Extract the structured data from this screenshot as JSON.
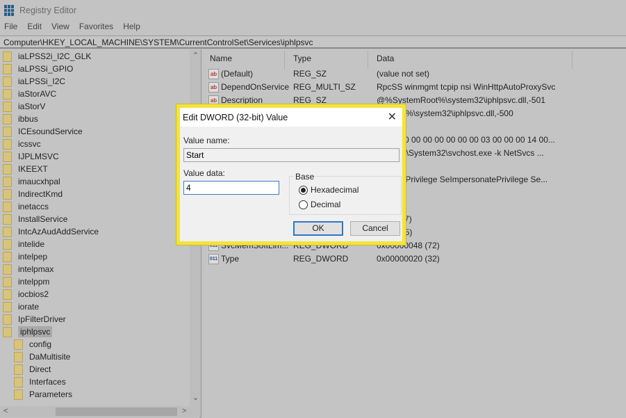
{
  "window": {
    "title": "Registry Editor",
    "app_icon": "registry-editor-icon"
  },
  "menu": [
    "File",
    "Edit",
    "View",
    "Favorites",
    "Help"
  ],
  "address": "Computer\\HKEY_LOCAL_MACHINE\\SYSTEM\\CurrentControlSet\\Services\\iphlpsvc",
  "tree": {
    "items": [
      "iaLPSS2i_I2C_GLK",
      "iaLPSSi_GPIO",
      "iaLPSSi_I2C",
      "iaStorAVC",
      "iaStorV",
      "ibbus",
      "ICEsoundService",
      "icssvc",
      "IJPLMSVC",
      "IKEEXT",
      "imaucxhpal",
      "IndirectKmd",
      "inetaccs",
      "InstallService",
      "IntcAzAudAddService",
      "intelide",
      "intelpep",
      "intelpmax",
      "intelppm",
      "iocbios2",
      "iorate",
      "IpFilterDriver",
      "iphlpsvc"
    ],
    "selected": "iphlpsvc",
    "children": [
      "config",
      "DaMultisite",
      "Direct",
      "Interfaces",
      "Parameters"
    ]
  },
  "list": {
    "headers": {
      "name": "Name",
      "type": "Type",
      "data": "Data"
    },
    "rows": [
      {
        "icon": "string-value-icon",
        "name": "(Default)",
        "type": "REG_SZ",
        "data": "(value not set)"
      },
      {
        "icon": "string-value-icon",
        "name": "DependOnService",
        "type": "REG_MULTI_SZ",
        "data": "RpcSS winmgmt tcpip nsi WinHttpAutoProxySvc"
      },
      {
        "icon": "string-value-icon",
        "name": "Description",
        "type": "REG_SZ",
        "data": "@%SystemRoot%\\system32\\iphlpsvc.dll,-501"
      },
      {
        "data": "emRoot%\\system32\\iphlpsvc.dll,-500"
      },
      {
        "data": "001 (1)"
      },
      {
        "data": "00 00 00 00 00 00 00 00 00 03 00 00 00 14 00..."
      },
      {
        "data": "nRoot%\\System32\\svchost.exe -k NetSvcs ..."
      },
      {
        "data": "stem"
      },
      {
        "data": "eGlobalPrivilege SeImpersonatePrivilege Se..."
      },
      {
        "data": "001 (1)"
      },
      {
        "data": "002 (2)"
      },
      {
        "data": "0c5 (197)"
      },
      {
        "data": "087 (135)"
      },
      {
        "icon": "dword-value-icon",
        "name": "SvcMemSoftLim...",
        "type": "REG_DWORD",
        "data": "0x00000048 (72)"
      },
      {
        "icon": "dword-value-icon",
        "name": "Type",
        "type": "REG_DWORD",
        "data": "0x00000020 (32)"
      }
    ]
  },
  "dialog": {
    "title": "Edit DWORD (32-bit) Value",
    "value_name_label": "Value name:",
    "value_name": "Start",
    "value_data_label": "Value data:",
    "value_data": "4",
    "base_label": "Base",
    "hex_label": "Hexadecimal",
    "dec_label": "Decimal",
    "selected_base": "Hexadecimal",
    "ok": "OK",
    "cancel": "Cancel",
    "highlight_color": "#f3e43c"
  }
}
